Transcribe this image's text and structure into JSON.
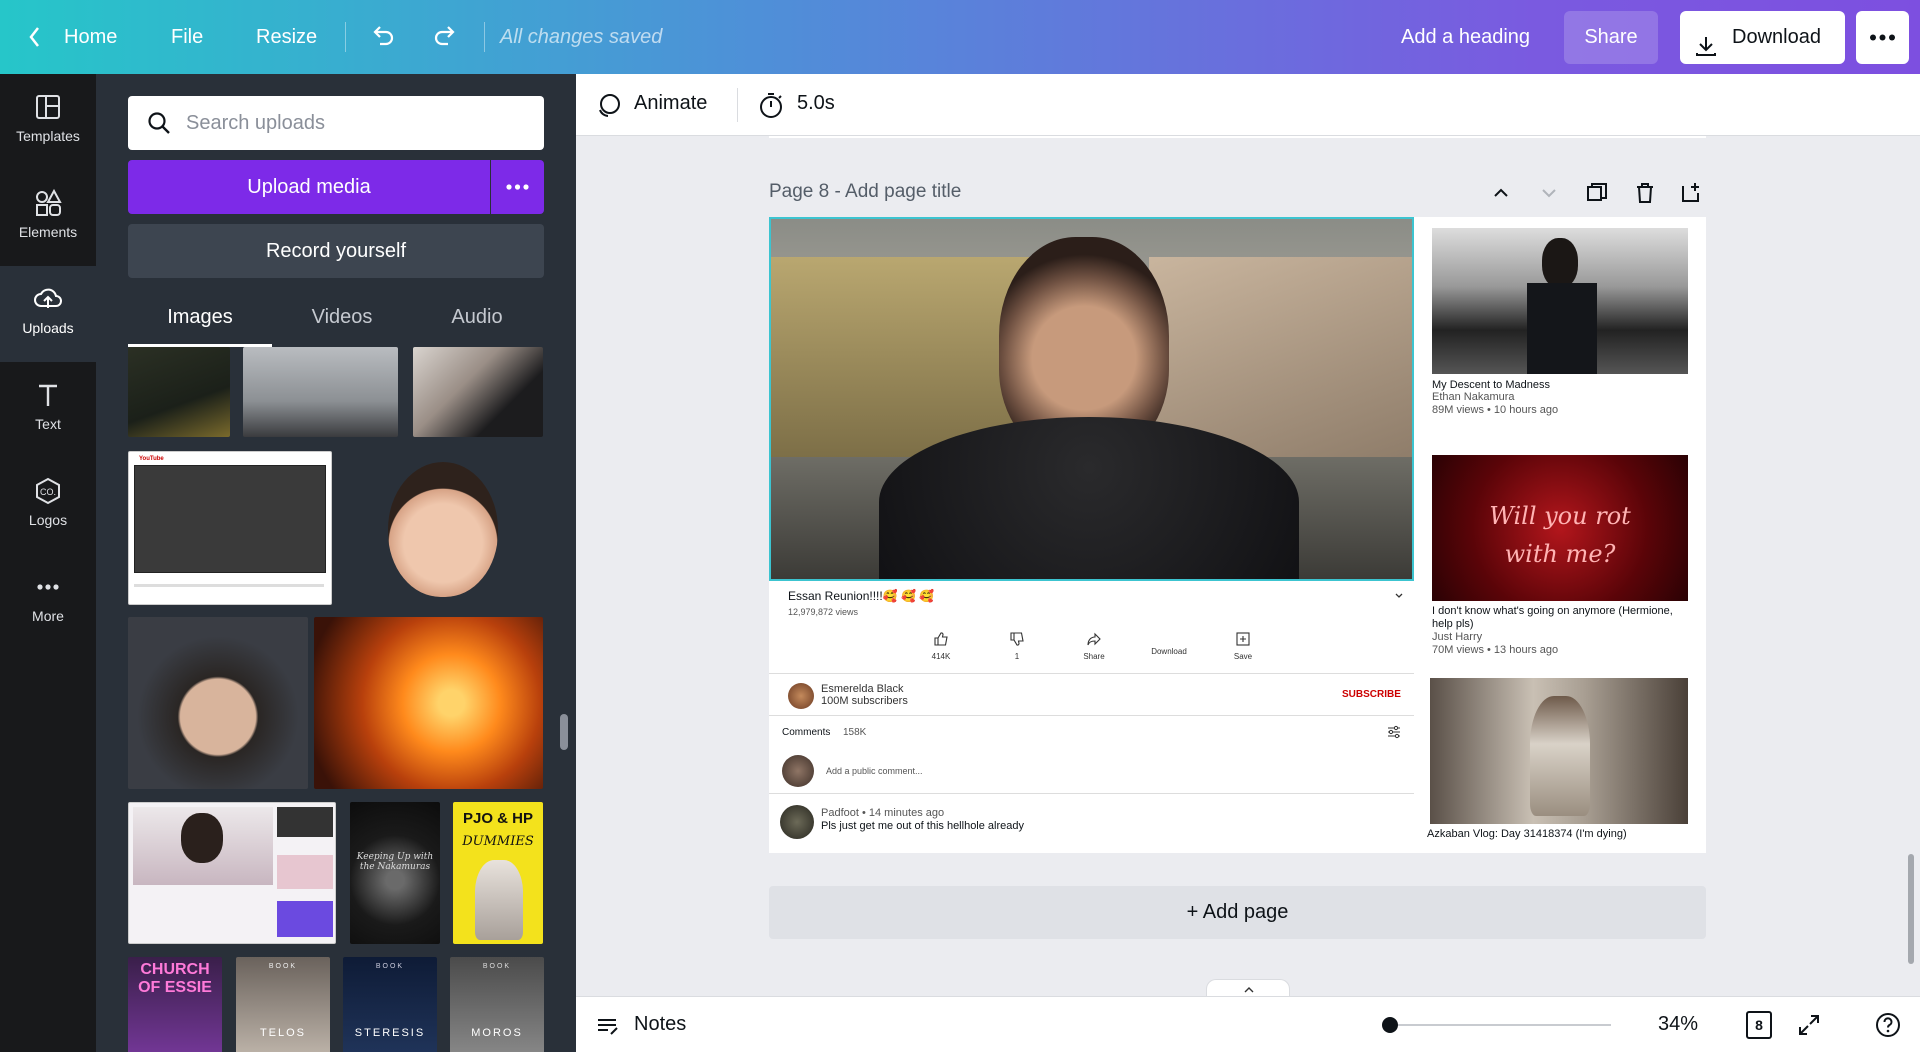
{
  "topbar": {
    "home": "Home",
    "file": "File",
    "resize": "Resize",
    "saved_status": "All changes saved",
    "heading": "Add a heading",
    "share": "Share",
    "download": "Download"
  },
  "rail": {
    "items": [
      {
        "label": "Templates",
        "icon": "templates-icon"
      },
      {
        "label": "Elements",
        "icon": "elements-icon"
      },
      {
        "label": "Uploads",
        "icon": "uploads-icon"
      },
      {
        "label": "Text",
        "icon": "text-icon"
      },
      {
        "label": "Logos",
        "icon": "logos-icon"
      },
      {
        "label": "More",
        "icon": "more-icon"
      }
    ],
    "logo_icon_text": "CO."
  },
  "panel": {
    "search_placeholder": "Search uploads",
    "upload_button": "Upload media",
    "record_button": "Record yourself",
    "tabs": [
      "Images",
      "Videos",
      "Audio"
    ],
    "thumb_texts": {
      "yt_badge": "YouTube",
      "pjo_title": "PJO & HP",
      "pjo_sub": "DUMMIES",
      "church": "CHURCH OF ESSIE",
      "book": "BOOK",
      "book1": "TELOS",
      "book2": "STERESIS",
      "book3": "MOROS",
      "keeping": "Keeping Up with the Nakamuras"
    }
  },
  "editor": {
    "animate": "Animate",
    "duration": "5.0s",
    "page_label": "Page 8 - Add page title",
    "add_page": "+ Add page",
    "notes": "Notes",
    "zoom": "34%",
    "page_count": "8"
  },
  "design": {
    "main_video": {
      "title": "Essan Reunion!!!!🥰 🥰 🥰",
      "views": "12,979,872 views",
      "likes": "414K",
      "dislikes": "1",
      "share": "Share",
      "download": "Download",
      "save": "Save",
      "channel": "Esmerelda Black",
      "subscribers": "100M subscribers",
      "subscribe": "SUBSCRIBE",
      "comments_label": "Comments",
      "comments_count": "158K",
      "comment_placeholder": "Add a public comment...",
      "comment_author": "Padfoot • 14 minutes ago",
      "comment_text": "Pls just get me out of this hellhole already"
    },
    "sidebar_videos": [
      {
        "title": "My Descent to Madness",
        "channel": "Ethan Nakamura",
        "meta": "89M views • 10 hours ago"
      },
      {
        "title": "I don't know what's going on anymore (Hermione, help pls)",
        "channel": "Just Harry",
        "meta": "70M views • 13 hours ago",
        "thumb_text": "Will you rot with me?"
      },
      {
        "title": "Azkaban Vlog: Day 31418374 (I'm dying)"
      }
    ]
  },
  "colors": {
    "accent": "#7d2ae8",
    "selection": "#3cc4d0",
    "subscribe": "#cc0000"
  }
}
